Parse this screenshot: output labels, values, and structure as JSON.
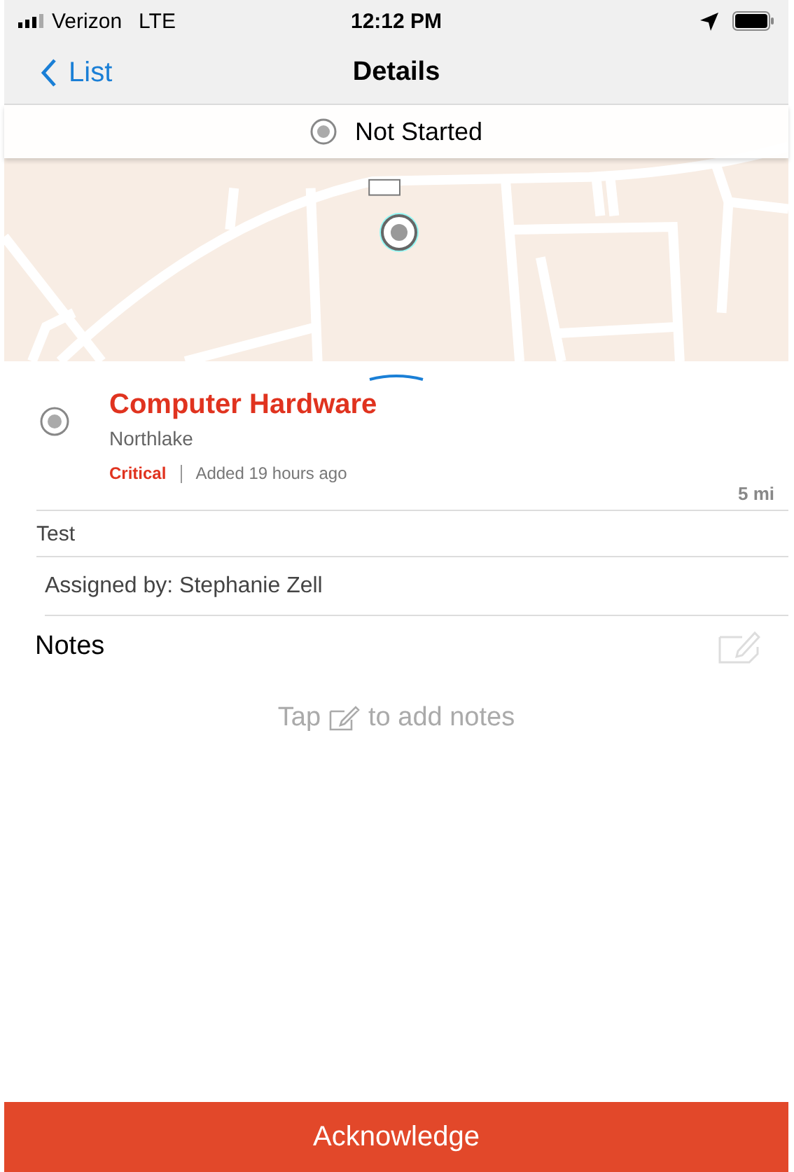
{
  "status_bar": {
    "carrier": "Verizon",
    "network": "LTE",
    "time": "12:12 PM"
  },
  "nav": {
    "back": "List",
    "title": "Details"
  },
  "status": {
    "label": "Not Started"
  },
  "item": {
    "title": "Computer Hardware",
    "location": "Northlake",
    "priority": "Critical",
    "added": "Added 19 hours ago",
    "distance": "5 mi"
  },
  "description": "Test",
  "assigned": "Assigned by: Stephanie Zell",
  "notes": {
    "heading": "Notes",
    "hint_before": "Tap",
    "hint_after": "to add notes"
  },
  "action": "Acknowledge"
}
